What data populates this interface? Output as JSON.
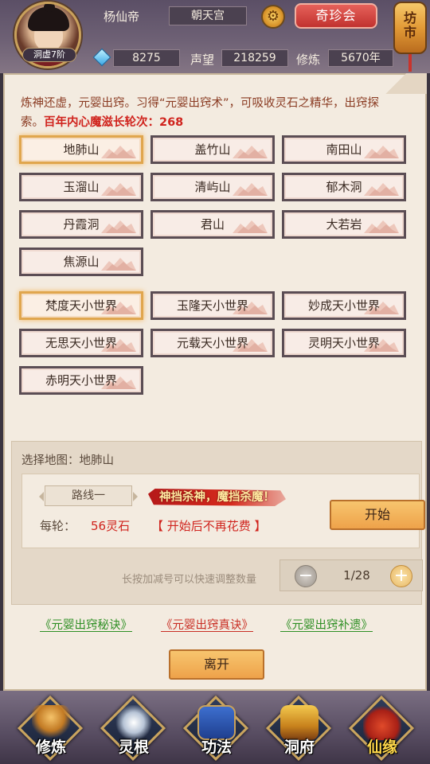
{
  "header": {
    "player_name": "杨仙帝",
    "rank": "洞虚7阶",
    "sect": "朝天宫",
    "treasure_label": "奇珍会",
    "market_label": "坊市",
    "gems": "8275",
    "reputation_label": "声望",
    "reputation": "218259",
    "cultivation_label": "修炼",
    "cultivation": "5670年"
  },
  "intro": {
    "text": "炼神还虚，元婴出窍。习得“元婴出窍术”，可吸收灵石之精华，出窍探索。",
    "count_text": "百年内心魔滋长轮次：268"
  },
  "maps": [
    "地肺山",
    "盖竹山",
    "南田山",
    "玉溜山",
    "清屿山",
    "郁木洞",
    "丹霞洞",
    "君山",
    "大若岩",
    "焦源山"
  ],
  "worlds": [
    "梵度天小世界",
    "玉隆天小世界",
    "妙成天小世界",
    "无思天小世界",
    "元载天小世界",
    "灵明天小世界",
    "赤明天小世界"
  ],
  "selection": {
    "label": "选择地图：",
    "map": "地肺山",
    "route": "路线一",
    "slogan": "神挡杀神，魔挡杀魔！",
    "cost_label": "每轮：",
    "cost": "56灵石",
    "cost_note": "【 开始后不再花费 】",
    "start_label": "开始",
    "hint": "长按加减号可以快速调整数量",
    "stepper_value": "1/28"
  },
  "links": [
    "《元婴出窍秘诀》",
    "《元婴出窍真诀》",
    "《元婴出窍补遗》"
  ],
  "leave_label": "离开",
  "nav": [
    {
      "label": "修炼",
      "icon": "meditating-figure-icon"
    },
    {
      "label": "灵根",
      "icon": "spirit-root-icon"
    },
    {
      "label": "功法",
      "icon": "scroll-book-icon"
    },
    {
      "label": "洞府",
      "icon": "pavilion-icon"
    },
    {
      "label": "仙缘",
      "icon": "gourd-icon"
    }
  ],
  "colors": {
    "accent_red": "#d0241e",
    "gold": "#eea24a",
    "link_green": "#2e8f24"
  }
}
